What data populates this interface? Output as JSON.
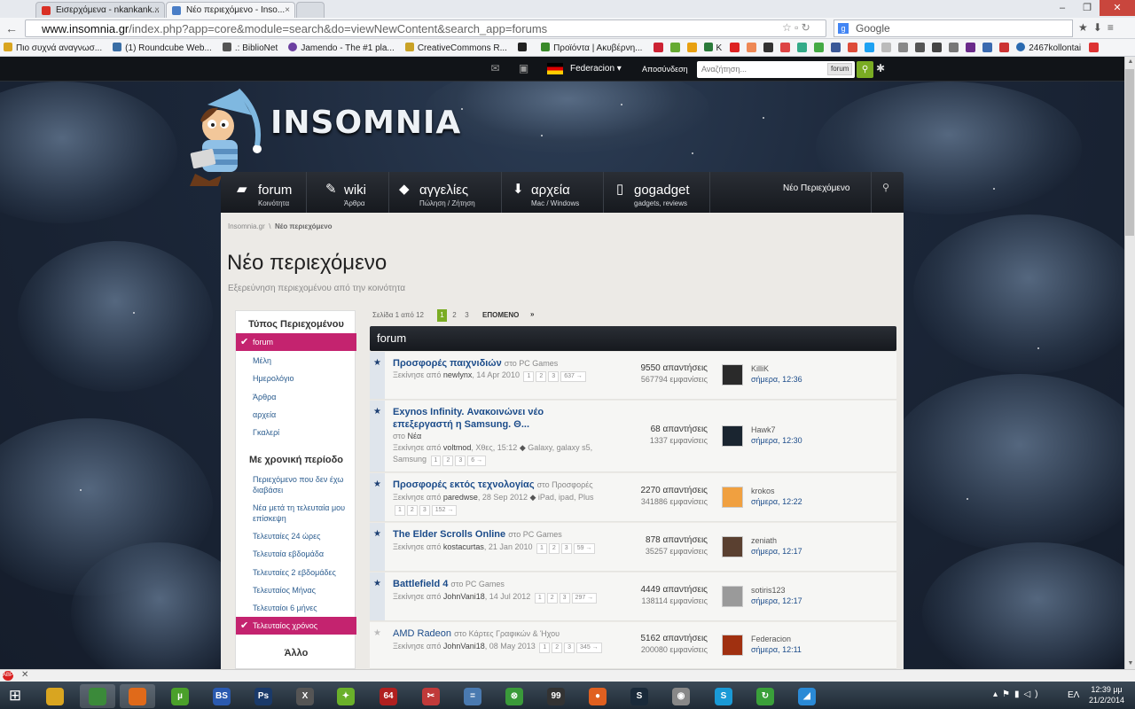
{
  "browser": {
    "tabs": [
      {
        "title": "Εισερχόμενα - nkankank...",
        "favicon_color": "#d93025"
      },
      {
        "title": "Νέο περιεχόμενο - Inso...",
        "favicon_color": "#4a7ec7"
      }
    ],
    "url_domain": "www.insomnia.gr",
    "url_path": "/index.php?app=core&module=search&do=viewNewContent&search_app=forums",
    "search_placeholder": "Google",
    "bookmarks": [
      {
        "label": "Πιο συχνά αναγνωσ...",
        "color": "#d9a520"
      },
      {
        "label": "(1) Roundcube Web...",
        "color": "#3a6ea5"
      },
      {
        "label": ".: BiblioNet",
        "color": "#555555"
      },
      {
        "label": "Jamendo - The #1 pla...",
        "color": "#6b3fa0"
      },
      {
        "label": "CreativeCommons R...",
        "color": "#c9a227"
      },
      {
        "label": "",
        "color": "#222222"
      },
      {
        "label": "Προϊόντα | Ακυβέρνη...",
        "color": "#3a8a2a"
      },
      {
        "label": "K",
        "color": "#2a7a3a"
      },
      {
        "label": "2467kollontai",
        "color": "#2a6ab0"
      }
    ]
  },
  "site_topbar": {
    "username": "Federacion ▾",
    "logout": "Αποσύνδεση",
    "search_placeholder": "Αναζήτηση...",
    "search_scope": "forum"
  },
  "logo": {
    "text": "INSOMNIA"
  },
  "mainnav": [
    {
      "title": "forum",
      "sub": "Κοινότητα",
      "icon": "chat-icon"
    },
    {
      "title": "wiki",
      "sub": "Άρθρα",
      "icon": "edit-icon"
    },
    {
      "title": "αγγελίες",
      "sub": "Πώληση / Ζήτηση",
      "icon": "tag-icon"
    },
    {
      "title": "αρχεία",
      "sub": "Mac / Windows",
      "icon": "download-icon"
    },
    {
      "title": "gogadget",
      "sub": "gadgets, reviews",
      "icon": "phone-icon"
    }
  ],
  "mainnav_new": "Νέο Περιεχόμενο",
  "breadcrumb": {
    "home": "Insomnia.gr",
    "sep": "\\",
    "current": "Νέο περιεχόμενο"
  },
  "page": {
    "title": "Νέο περιεχόμενο",
    "subtitle": "Εξερεύνηση περιεχομένου από την κοινότητα"
  },
  "sidebar": {
    "type_head": "Τύπος Περιεχομένου",
    "types": [
      "forum",
      "Μέλη",
      "Ημερολόγιο",
      "Άρθρα",
      "αρχεία",
      "Γκαλερί"
    ],
    "period_head": "Με χρονική περίοδο",
    "periods": [
      "Περιεχόμενο που δεν έχω διαβάσει",
      "Νέα μετά τη τελευταία μου επίσκεψη",
      "Τελευταίες 24 ώρες",
      "Τελευταία εβδομάδα",
      "Τελευταίες 2 εβδομάδες",
      "Τελευταίος Μήνας",
      "Τελευταίοι 6 μήνες",
      "Τελευταίος χρόνος"
    ],
    "other_head": "Άλλο"
  },
  "pager": {
    "label": "Σελίδα 1 από 12",
    "pages": [
      "1",
      "2",
      "3"
    ],
    "next": "ΕΠΟΜΕΝΟ",
    "last": "»"
  },
  "section_title": "forum",
  "topics": [
    {
      "title": "Προσφορές παιχνιδιών",
      "forum": "PC Games",
      "meta": "Ξεκίνησε από",
      "author": "newlynx",
      "date": "14 Apr 2010",
      "pages": [
        "1",
        "2",
        "3",
        "637 →"
      ],
      "tags": "",
      "replies": "9550 απαντήσεις",
      "views": "567794 εμφανίσεις",
      "last_user": "KilliK",
      "last_time": "σήμερα, 12:36",
      "unread": true,
      "avatar": "#2a2a2a"
    },
    {
      "title": "Exynos Infinity. Ανακοινώνει νέο επεξεργαστή η Samsung. Θ...",
      "forum": "Νέα",
      "meta": "Ξεκίνησε από",
      "author": "voltmod",
      "date": "Χθες, 15:12",
      "pages": [
        "1",
        "2",
        "3",
        "6 →"
      ],
      "tags": "Galaxy, galaxy s5, Samsung",
      "replies": "68 απαντήσεις",
      "views": "1337 εμφανίσεις",
      "last_user": "Hawk7",
      "last_time": "σήμερα, 12:30",
      "unread": true,
      "avatar": "#1a2530"
    },
    {
      "title": "Προσφορές εκτός τεχνολογίας",
      "forum": "Προσφορές",
      "meta": "Ξεκίνησε από",
      "author": "paredwse",
      "date": "28 Sep 2012",
      "pages": [
        "1",
        "2",
        "3",
        "152 →"
      ],
      "tags": "iPad, ipad, Plus",
      "replies": "2270 απαντήσεις",
      "views": "341886 εμφανίσεις",
      "last_user": "krokos",
      "last_time": "σήμερα, 12:22",
      "unread": true,
      "avatar": "#f0a040"
    },
    {
      "title": "The Elder Scrolls Online",
      "forum": "PC Games",
      "meta": "Ξεκίνησε από",
      "author": "kostacurtas",
      "date": "21 Jan 2010",
      "pages": [
        "1",
        "2",
        "3",
        "59 →"
      ],
      "tags": "",
      "replies": "878 απαντήσεις",
      "views": "35257 εμφανίσεις",
      "last_user": "zeniath",
      "last_time": "σήμερα, 12:17",
      "unread": true,
      "avatar": "#5a4030"
    },
    {
      "title": "Battlefield 4",
      "forum": "PC Games",
      "meta": "Ξεκίνησε από",
      "author": "JohnVani18",
      "date": "14 Jul 2012",
      "pages": [
        "1",
        "2",
        "3",
        "297 →"
      ],
      "tags": "",
      "replies": "4449 απαντήσεις",
      "views": "138114 εμφανίσεις",
      "last_user": "sotiris123",
      "last_time": "σήμερα, 12:17",
      "unread": true,
      "avatar": "#9a9a9a"
    },
    {
      "title": "AMD Radeon",
      "forum": "Κάρτες Γραφικών & Ήχου",
      "meta": "Ξεκίνησε από",
      "author": "JohnVani18",
      "date": "08 May 2013",
      "pages": [
        "1",
        "2",
        "3",
        "345 →"
      ],
      "tags": "",
      "replies": "5162 απαντήσεις",
      "views": "200080 εμφανίσεις",
      "last_user": "Federacion",
      "last_time": "σήμερα, 12:11",
      "unread": false,
      "avatar": "#a03010"
    }
  ],
  "taskbar": {
    "apps": [
      {
        "name": "explorer",
        "color": "#d9a520",
        "label": ""
      },
      {
        "name": "chrome",
        "color": "#3b8a3a",
        "label": ""
      },
      {
        "name": "firefox",
        "color": "#e06a1a",
        "label": ""
      },
      {
        "name": "utorrent",
        "color": "#4aa02a",
        "label": "µ"
      },
      {
        "name": "bsplayer",
        "color": "#2a5ab0",
        "label": "BS"
      },
      {
        "name": "photoshop",
        "color": "#1a3a6a",
        "label": "Ps"
      },
      {
        "name": "app-x",
        "color": "#555555",
        "label": "X"
      },
      {
        "name": "app-star",
        "color": "#6ab02a",
        "label": "✦"
      },
      {
        "name": "app-64",
        "color": "#b02020",
        "label": "64"
      },
      {
        "name": "app-snip",
        "color": "#c03a3a",
        "label": "✂"
      },
      {
        "name": "calculator",
        "color": "#4a7ab0",
        "label": "="
      },
      {
        "name": "xbox",
        "color": "#3a9a3a",
        "label": "⊗"
      },
      {
        "name": "app-99",
        "color": "#333333",
        "label": "99"
      },
      {
        "name": "app-orange",
        "color": "#e06020",
        "label": "●"
      },
      {
        "name": "steam",
        "color": "#1a2a3a",
        "label": "S"
      },
      {
        "name": "app-cam",
        "color": "#888888",
        "label": "◉"
      },
      {
        "name": "skype",
        "color": "#1a9ad6",
        "label": "S"
      },
      {
        "name": "app-sync",
        "color": "#3aa03a",
        "label": "↻"
      },
      {
        "name": "app-net",
        "color": "#2a8ad6",
        "label": "◢"
      }
    ],
    "lang": "ΕΛ",
    "time": "12:39 μμ",
    "date": "21/2/2014"
  }
}
